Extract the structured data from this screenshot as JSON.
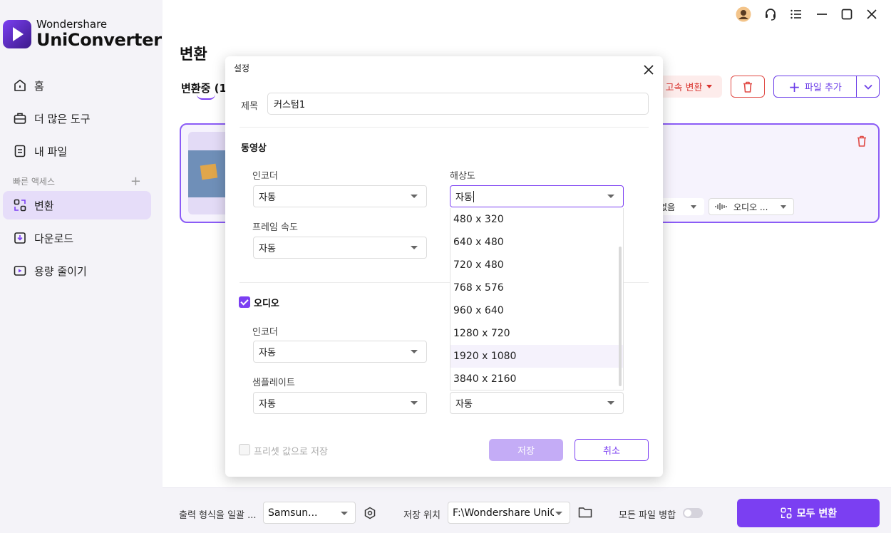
{
  "app": {
    "brand": "Wondershare",
    "product": "UniConverter"
  },
  "sidebar": {
    "items": [
      {
        "label": "홈",
        "icon": "home-icon"
      },
      {
        "label": "더 많은 도구",
        "icon": "toolbox-icon"
      },
      {
        "label": "내 파일",
        "icon": "file-icon"
      }
    ],
    "quick_access_label": "빠른 액세스",
    "quick_items": [
      {
        "label": "변환",
        "icon": "convert-icon",
        "active": true
      },
      {
        "label": "다운로드",
        "icon": "download-icon"
      },
      {
        "label": "용량 줄이기",
        "icon": "compress-icon"
      }
    ]
  },
  "main": {
    "title": "변환",
    "tab_converting": "변환중 (1",
    "high_speed_label": "고속 변환",
    "add_file_label": "파일 추가",
    "card": {
      "subtitle_label": "없음",
      "audio_label": "오디오 ..."
    }
  },
  "bottombar": {
    "output_format_label": "출력 형식을 일괄 ...",
    "output_format_value": "Samsun...",
    "save_location_label": "저장 위치",
    "save_location_value": "F:\\Wondershare UniCo",
    "merge_label": "모든 파일 병합",
    "convert_all_label": "모두 변환"
  },
  "dialog": {
    "title": "설정",
    "name_label": "제목",
    "name_value": "커스텀1",
    "video_section": "동영상",
    "video_encoder_label": "인코더",
    "video_encoder_value": "자동",
    "resolution_label": "해상도",
    "resolution_value": "자동",
    "frame_rate_label": "프레임 속도",
    "frame_rate_value": "자동",
    "audio_section": "오디오",
    "audio_encoder_label": "인코더",
    "audio_encoder_value": "자동",
    "sample_rate_label": "샘플레이트",
    "sample_rate_value": "자동",
    "bitrate_value": "자동",
    "resolution_options": [
      "480 x 320",
      "640 x 480",
      "720 x 480",
      "768 x 576",
      "960 x 640",
      "1280 x 720",
      "1920 x 1080",
      "3840 x 2160"
    ],
    "save_preset_label": "프리셋 값으로 저장",
    "save_label": "저장",
    "cancel_label": "취소"
  },
  "colors": {
    "accent": "#7b3ff2",
    "danger": "#d9332e",
    "sidebar_bg": "#f4f3f8"
  }
}
